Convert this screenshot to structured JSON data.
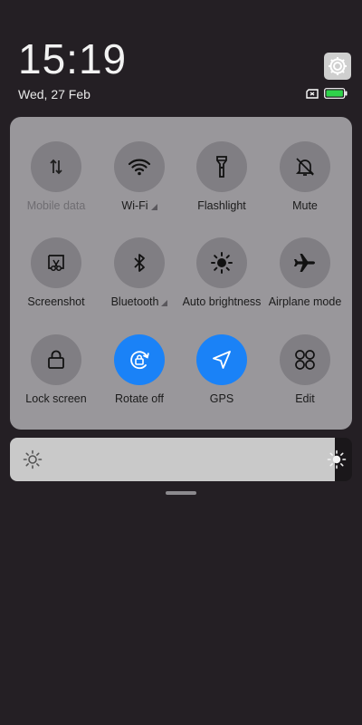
{
  "status": {
    "time": "15:19",
    "date": "Wed, 27 Feb",
    "battery_color": "#2fd34a"
  },
  "tiles": [
    {
      "label": "Mobile data",
      "icon": "mobile-data-icon",
      "active": false,
      "dim": true
    },
    {
      "label": "Wi-Fi",
      "icon": "wifi-icon",
      "active": false,
      "expand": true
    },
    {
      "label": "Flashlight",
      "icon": "flashlight-icon",
      "active": false
    },
    {
      "label": "Mute",
      "icon": "mute-icon",
      "active": false
    },
    {
      "label": "Screenshot",
      "icon": "screenshot-icon",
      "active": false
    },
    {
      "label": "Bluetooth",
      "icon": "bluetooth-icon",
      "active": false,
      "expand": true
    },
    {
      "label": "Auto brightness",
      "icon": "auto-brightness-icon",
      "active": false
    },
    {
      "label": "Airplane mode",
      "icon": "airplane-icon",
      "active": false
    },
    {
      "label": "Lock screen",
      "icon": "lock-icon",
      "active": false
    },
    {
      "label": "Rotate off",
      "icon": "rotate-lock-icon",
      "active": true
    },
    {
      "label": "GPS",
      "icon": "gps-icon",
      "active": true
    },
    {
      "label": "Edit",
      "icon": "edit-grid-icon",
      "active": false
    }
  ],
  "brightness": {
    "level_fraction": 0.95,
    "icon": "sun-icon"
  },
  "colors": {
    "accent": "#1a82f7",
    "panel": "#99979b",
    "background": "#241f24"
  }
}
